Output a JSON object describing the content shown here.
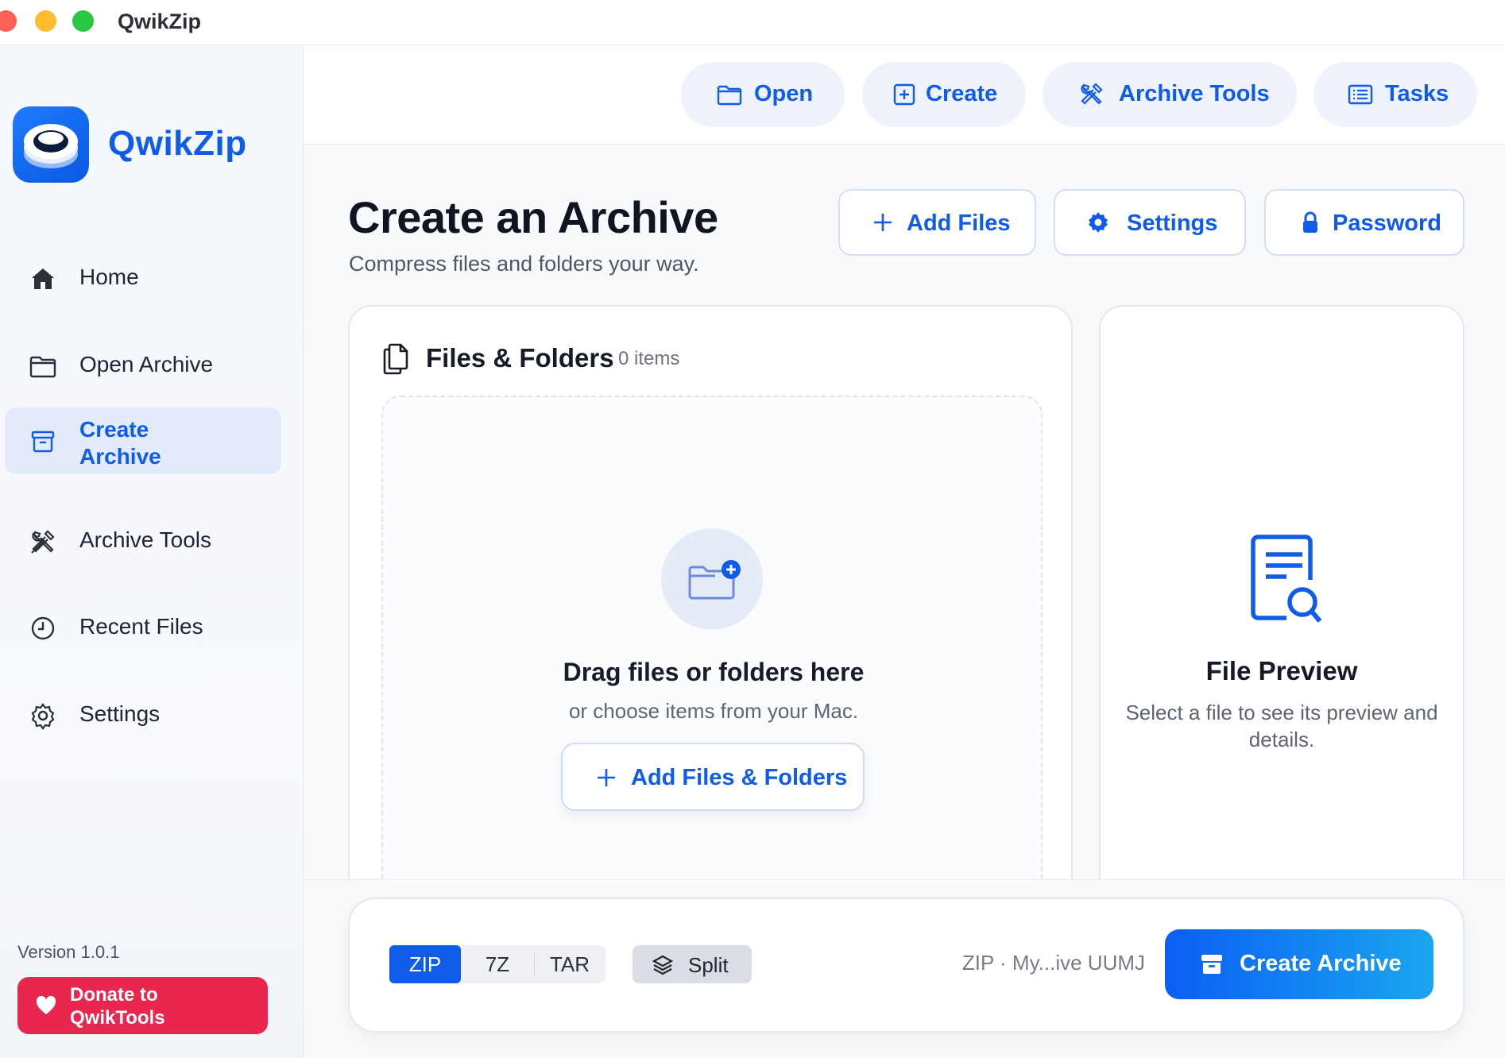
{
  "window": {
    "title": "QwikZip"
  },
  "sidebar": {
    "brand": "QwikZip",
    "items": [
      {
        "label": "Home",
        "icon": "home-icon"
      },
      {
        "label": "Open Archive",
        "icon": "folder-icon"
      },
      {
        "label": "Create Archive",
        "icon": "archive-box-icon",
        "active": true
      },
      {
        "label": "Archive Tools",
        "icon": "tools-icon"
      },
      {
        "label": "Recent Files",
        "icon": "clock-icon"
      },
      {
        "label": "Settings",
        "icon": "gear-icon"
      }
    ],
    "version": "Version 1.0.1",
    "donate_label": "Donate to QwikTools"
  },
  "toolbar": {
    "open_label": "Open",
    "create_label": "Create",
    "archive_tools_label": "Archive Tools",
    "tasks_label": "Tasks"
  },
  "page": {
    "title": "Create an Archive",
    "subtitle": "Compress files and folders your way.",
    "add_files_label": "Add Files",
    "settings_label": "Settings",
    "password_label": "Password"
  },
  "files_panel": {
    "title": "Files & Folders",
    "count": "0 items",
    "drop_title": "Drag files or folders here",
    "drop_subtitle": "or choose items from your Mac.",
    "add_button_label": "Add Files & Folders"
  },
  "preview_panel": {
    "title": "File Preview",
    "subtitle": "Select a file to see its preview and details."
  },
  "bottom_bar": {
    "formats": [
      "ZIP",
      "7Z",
      "TAR"
    ],
    "selected_format": "ZIP",
    "split_label": "Split",
    "summary": "ZIP · My...ive UUMJ",
    "create_label": "Create Archive"
  },
  "colors": {
    "accent": "#0f5bea",
    "active_nav_bg": "#e2eafc",
    "donate": "#e8264e",
    "traffic_red": "#fe5f57",
    "traffic_yellow": "#febc2e",
    "traffic_green": "#28c840"
  }
}
